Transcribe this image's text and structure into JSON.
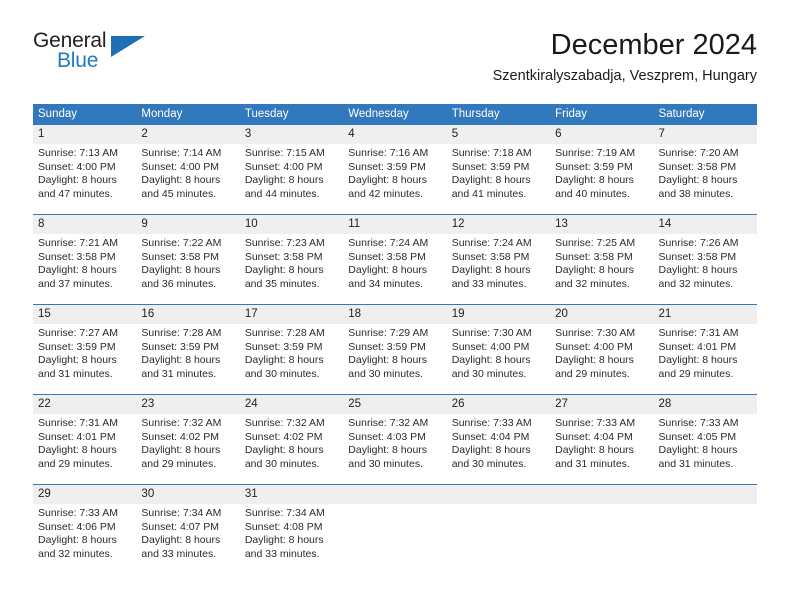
{
  "brand": {
    "name_part1": "General",
    "name_part2": "Blue",
    "triangle_color": "#1f6fb5",
    "blue_color": "#1f7ac4"
  },
  "header": {
    "title": "December 2024",
    "subtitle": "Szentkiralyszabadja, Veszprem, Hungary"
  },
  "theme": {
    "header_blue": "#3178bd",
    "daynum_band": "#efefef",
    "text": "#2b2b2b"
  },
  "weekdays": [
    "Sunday",
    "Monday",
    "Tuesday",
    "Wednesday",
    "Thursday",
    "Friday",
    "Saturday"
  ],
  "weeks": [
    {
      "daynums": [
        "1",
        "2",
        "3",
        "4",
        "5",
        "6",
        "7"
      ],
      "days": [
        {
          "day": "1",
          "sunrise": "Sunrise: 7:13 AM",
          "sunset": "Sunset: 4:00 PM",
          "daylight_line1": "Daylight: 8 hours",
          "daylight_line2": "and 47 minutes."
        },
        {
          "day": "2",
          "sunrise": "Sunrise: 7:14 AM",
          "sunset": "Sunset: 4:00 PM",
          "daylight_line1": "Daylight: 8 hours",
          "daylight_line2": "and 45 minutes."
        },
        {
          "day": "3",
          "sunrise": "Sunrise: 7:15 AM",
          "sunset": "Sunset: 4:00 PM",
          "daylight_line1": "Daylight: 8 hours",
          "daylight_line2": "and 44 minutes."
        },
        {
          "day": "4",
          "sunrise": "Sunrise: 7:16 AM",
          "sunset": "Sunset: 3:59 PM",
          "daylight_line1": "Daylight: 8 hours",
          "daylight_line2": "and 42 minutes."
        },
        {
          "day": "5",
          "sunrise": "Sunrise: 7:18 AM",
          "sunset": "Sunset: 3:59 PM",
          "daylight_line1": "Daylight: 8 hours",
          "daylight_line2": "and 41 minutes."
        },
        {
          "day": "6",
          "sunrise": "Sunrise: 7:19 AM",
          "sunset": "Sunset: 3:59 PM",
          "daylight_line1": "Daylight: 8 hours",
          "daylight_line2": "and 40 minutes."
        },
        {
          "day": "7",
          "sunrise": "Sunrise: 7:20 AM",
          "sunset": "Sunset: 3:58 PM",
          "daylight_line1": "Daylight: 8 hours",
          "daylight_line2": "and 38 minutes."
        }
      ]
    },
    {
      "daynums": [
        "8",
        "9",
        "10",
        "11",
        "12",
        "13",
        "14"
      ],
      "days": [
        {
          "day": "8",
          "sunrise": "Sunrise: 7:21 AM",
          "sunset": "Sunset: 3:58 PM",
          "daylight_line1": "Daylight: 8 hours",
          "daylight_line2": "and 37 minutes."
        },
        {
          "day": "9",
          "sunrise": "Sunrise: 7:22 AM",
          "sunset": "Sunset: 3:58 PM",
          "daylight_line1": "Daylight: 8 hours",
          "daylight_line2": "and 36 minutes."
        },
        {
          "day": "10",
          "sunrise": "Sunrise: 7:23 AM",
          "sunset": "Sunset: 3:58 PM",
          "daylight_line1": "Daylight: 8 hours",
          "daylight_line2": "and 35 minutes."
        },
        {
          "day": "11",
          "sunrise": "Sunrise: 7:24 AM",
          "sunset": "Sunset: 3:58 PM",
          "daylight_line1": "Daylight: 8 hours",
          "daylight_line2": "and 34 minutes."
        },
        {
          "day": "12",
          "sunrise": "Sunrise: 7:24 AM",
          "sunset": "Sunset: 3:58 PM",
          "daylight_line1": "Daylight: 8 hours",
          "daylight_line2": "and 33 minutes."
        },
        {
          "day": "13",
          "sunrise": "Sunrise: 7:25 AM",
          "sunset": "Sunset: 3:58 PM",
          "daylight_line1": "Daylight: 8 hours",
          "daylight_line2": "and 32 minutes."
        },
        {
          "day": "14",
          "sunrise": "Sunrise: 7:26 AM",
          "sunset": "Sunset: 3:58 PM",
          "daylight_line1": "Daylight: 8 hours",
          "daylight_line2": "and 32 minutes."
        }
      ]
    },
    {
      "daynums": [
        "15",
        "16",
        "17",
        "18",
        "19",
        "20",
        "21"
      ],
      "days": [
        {
          "day": "15",
          "sunrise": "Sunrise: 7:27 AM",
          "sunset": "Sunset: 3:59 PM",
          "daylight_line1": "Daylight: 8 hours",
          "daylight_line2": "and 31 minutes."
        },
        {
          "day": "16",
          "sunrise": "Sunrise: 7:28 AM",
          "sunset": "Sunset: 3:59 PM",
          "daylight_line1": "Daylight: 8 hours",
          "daylight_line2": "and 31 minutes."
        },
        {
          "day": "17",
          "sunrise": "Sunrise: 7:28 AM",
          "sunset": "Sunset: 3:59 PM",
          "daylight_line1": "Daylight: 8 hours",
          "daylight_line2": "and 30 minutes."
        },
        {
          "day": "18",
          "sunrise": "Sunrise: 7:29 AM",
          "sunset": "Sunset: 3:59 PM",
          "daylight_line1": "Daylight: 8 hours",
          "daylight_line2": "and 30 minutes."
        },
        {
          "day": "19",
          "sunrise": "Sunrise: 7:30 AM",
          "sunset": "Sunset: 4:00 PM",
          "daylight_line1": "Daylight: 8 hours",
          "daylight_line2": "and 30 minutes."
        },
        {
          "day": "20",
          "sunrise": "Sunrise: 7:30 AM",
          "sunset": "Sunset: 4:00 PM",
          "daylight_line1": "Daylight: 8 hours",
          "daylight_line2": "and 29 minutes."
        },
        {
          "day": "21",
          "sunrise": "Sunrise: 7:31 AM",
          "sunset": "Sunset: 4:01 PM",
          "daylight_line1": "Daylight: 8 hours",
          "daylight_line2": "and 29 minutes."
        }
      ]
    },
    {
      "daynums": [
        "22",
        "23",
        "24",
        "25",
        "26",
        "27",
        "28"
      ],
      "days": [
        {
          "day": "22",
          "sunrise": "Sunrise: 7:31 AM",
          "sunset": "Sunset: 4:01 PM",
          "daylight_line1": "Daylight: 8 hours",
          "daylight_line2": "and 29 minutes."
        },
        {
          "day": "23",
          "sunrise": "Sunrise: 7:32 AM",
          "sunset": "Sunset: 4:02 PM",
          "daylight_line1": "Daylight: 8 hours",
          "daylight_line2": "and 29 minutes."
        },
        {
          "day": "24",
          "sunrise": "Sunrise: 7:32 AM",
          "sunset": "Sunset: 4:02 PM",
          "daylight_line1": "Daylight: 8 hours",
          "daylight_line2": "and 30 minutes."
        },
        {
          "day": "25",
          "sunrise": "Sunrise: 7:32 AM",
          "sunset": "Sunset: 4:03 PM",
          "daylight_line1": "Daylight: 8 hours",
          "daylight_line2": "and 30 minutes."
        },
        {
          "day": "26",
          "sunrise": "Sunrise: 7:33 AM",
          "sunset": "Sunset: 4:04 PM",
          "daylight_line1": "Daylight: 8 hours",
          "daylight_line2": "and 30 minutes."
        },
        {
          "day": "27",
          "sunrise": "Sunrise: 7:33 AM",
          "sunset": "Sunset: 4:04 PM",
          "daylight_line1": "Daylight: 8 hours",
          "daylight_line2": "and 31 minutes."
        },
        {
          "day": "28",
          "sunrise": "Sunrise: 7:33 AM",
          "sunset": "Sunset: 4:05 PM",
          "daylight_line1": "Daylight: 8 hours",
          "daylight_line2": "and 31 minutes."
        }
      ]
    },
    {
      "daynums": [
        "29",
        "30",
        "31",
        "",
        "",
        "",
        ""
      ],
      "days": [
        {
          "day": "29",
          "sunrise": "Sunrise: 7:33 AM",
          "sunset": "Sunset: 4:06 PM",
          "daylight_line1": "Daylight: 8 hours",
          "daylight_line2": "and 32 minutes."
        },
        {
          "day": "30",
          "sunrise": "Sunrise: 7:34 AM",
          "sunset": "Sunset: 4:07 PM",
          "daylight_line1": "Daylight: 8 hours",
          "daylight_line2": "and 33 minutes."
        },
        {
          "day": "31",
          "sunrise": "Sunrise: 7:34 AM",
          "sunset": "Sunset: 4:08 PM",
          "daylight_line1": "Daylight: 8 hours",
          "daylight_line2": "and 33 minutes."
        },
        {
          "day": "",
          "sunrise": "",
          "sunset": "",
          "daylight_line1": "",
          "daylight_line2": ""
        },
        {
          "day": "",
          "sunrise": "",
          "sunset": "",
          "daylight_line1": "",
          "daylight_line2": ""
        },
        {
          "day": "",
          "sunrise": "",
          "sunset": "",
          "daylight_line1": "",
          "daylight_line2": ""
        },
        {
          "day": "",
          "sunrise": "",
          "sunset": "",
          "daylight_line1": "",
          "daylight_line2": ""
        }
      ]
    }
  ]
}
